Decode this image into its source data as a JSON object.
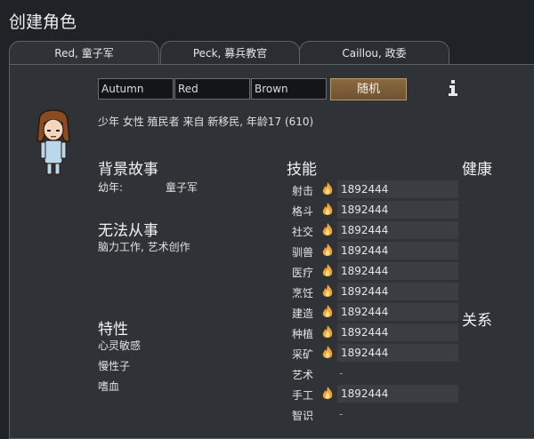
{
  "window": {
    "title": "创建角色"
  },
  "tabs": [
    {
      "label": "Red, 童子军",
      "active": true
    },
    {
      "label": "Peck, 募兵教官",
      "active": false
    },
    {
      "label": "Caillou, 政委",
      "active": false
    }
  ],
  "name": {
    "first": "Autumn",
    "nick": "Red",
    "last": "Brown",
    "random_label": "随机",
    "info_icon": "info-icon"
  },
  "description": "少年 女性 殖民者 来自 新移民, 年龄17 (610)",
  "backstory": {
    "heading": "背景故事",
    "childhood_label": "幼年:",
    "childhood_value": "童子军"
  },
  "incapable": {
    "heading": "无法从事",
    "value": "脑力工作, 艺术创作"
  },
  "traits": {
    "heading": "特性",
    "items": [
      "心灵敏感",
      "慢性子",
      "嗜血"
    ]
  },
  "skills": {
    "heading": "技能",
    "rows": [
      {
        "name": "射击",
        "passion": true,
        "value": "1892444"
      },
      {
        "name": "格斗",
        "passion": true,
        "value": "1892444"
      },
      {
        "name": "社交",
        "passion": true,
        "value": "1892444"
      },
      {
        "name": "驯兽",
        "passion": true,
        "value": "1892444"
      },
      {
        "name": "医疗",
        "passion": true,
        "value": "1892444"
      },
      {
        "name": "烹饪",
        "passion": true,
        "value": "1892444"
      },
      {
        "name": "建造",
        "passion": true,
        "value": "1892444"
      },
      {
        "name": "种植",
        "passion": true,
        "value": "1892444"
      },
      {
        "name": "采矿",
        "passion": true,
        "value": "1892444"
      },
      {
        "name": "艺术",
        "passion": false,
        "value": "-"
      },
      {
        "name": "手工",
        "passion": true,
        "value": "1892444"
      },
      {
        "name": "智识",
        "passion": false,
        "value": "-"
      }
    ]
  },
  "health": {
    "heading": "健康"
  },
  "relations": {
    "heading": "关系"
  },
  "colors": {
    "accent": "#8a6a40",
    "flame": "#f2a33a",
    "panel": "#2f3236"
  }
}
